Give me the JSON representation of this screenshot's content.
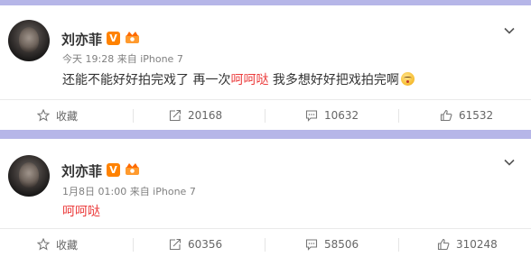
{
  "posts": [
    {
      "author": "刘亦菲",
      "verified_badge": "V",
      "meta": "今天 19:28 来自 iPhone 7",
      "content": {
        "part1": "还能不能好好拍完戏了 再一次",
        "highlight": "呵呵哒",
        "part2": " 我多想好好把戏拍完啊"
      },
      "actions": {
        "favorite": "收藏",
        "repost": "20168",
        "comment": "10632",
        "like": "61532"
      }
    },
    {
      "author": "刘亦菲",
      "verified_badge": "V",
      "meta": "1月8日 01:00 来自 iPhone 7",
      "content": {
        "highlight": "呵呵哒"
      },
      "actions": {
        "favorite": "收藏",
        "repost": "60356",
        "comment": "58506",
        "like": "310248"
      }
    }
  ],
  "colors": {
    "accent_red": "#eb3b3b",
    "divider": "#b6b6e8",
    "vip_orange": "#ff8200"
  },
  "icons": [
    "star-icon",
    "repost-icon",
    "comment-icon",
    "thumbs-up-icon",
    "chevron-down-icon",
    "crown-badge-icon",
    "emoji-face-icon"
  ]
}
